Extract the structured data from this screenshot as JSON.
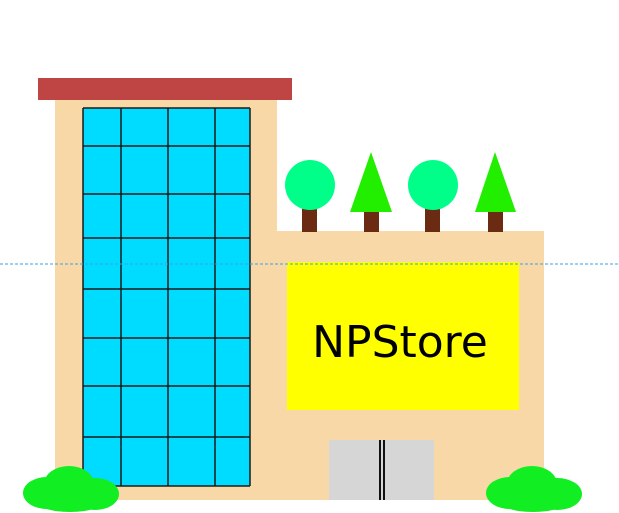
{
  "store": {
    "sign_text": "NPStore"
  },
  "colors": {
    "background": "#ffffff",
    "wall": "#f8d8a6",
    "roof": "#bf4444",
    "glass": "#00dcff",
    "glass_grid": "#1a1a1a",
    "sign": "#ffff00",
    "door": "#d6d6d6",
    "door_line": "#111111",
    "tree_trunk": "#6b2a12",
    "tree_round": "#00ff88",
    "tree_cone": "#22ee00",
    "bush": "#11ee22",
    "guide_line": "#3aa0e8"
  },
  "icons": {
    "rooftop_trees": [
      "round-tree-icon",
      "cone-tree-icon",
      "round-tree-icon",
      "cone-tree-icon"
    ],
    "bushes": [
      "bush-icon",
      "bush-icon"
    ]
  }
}
